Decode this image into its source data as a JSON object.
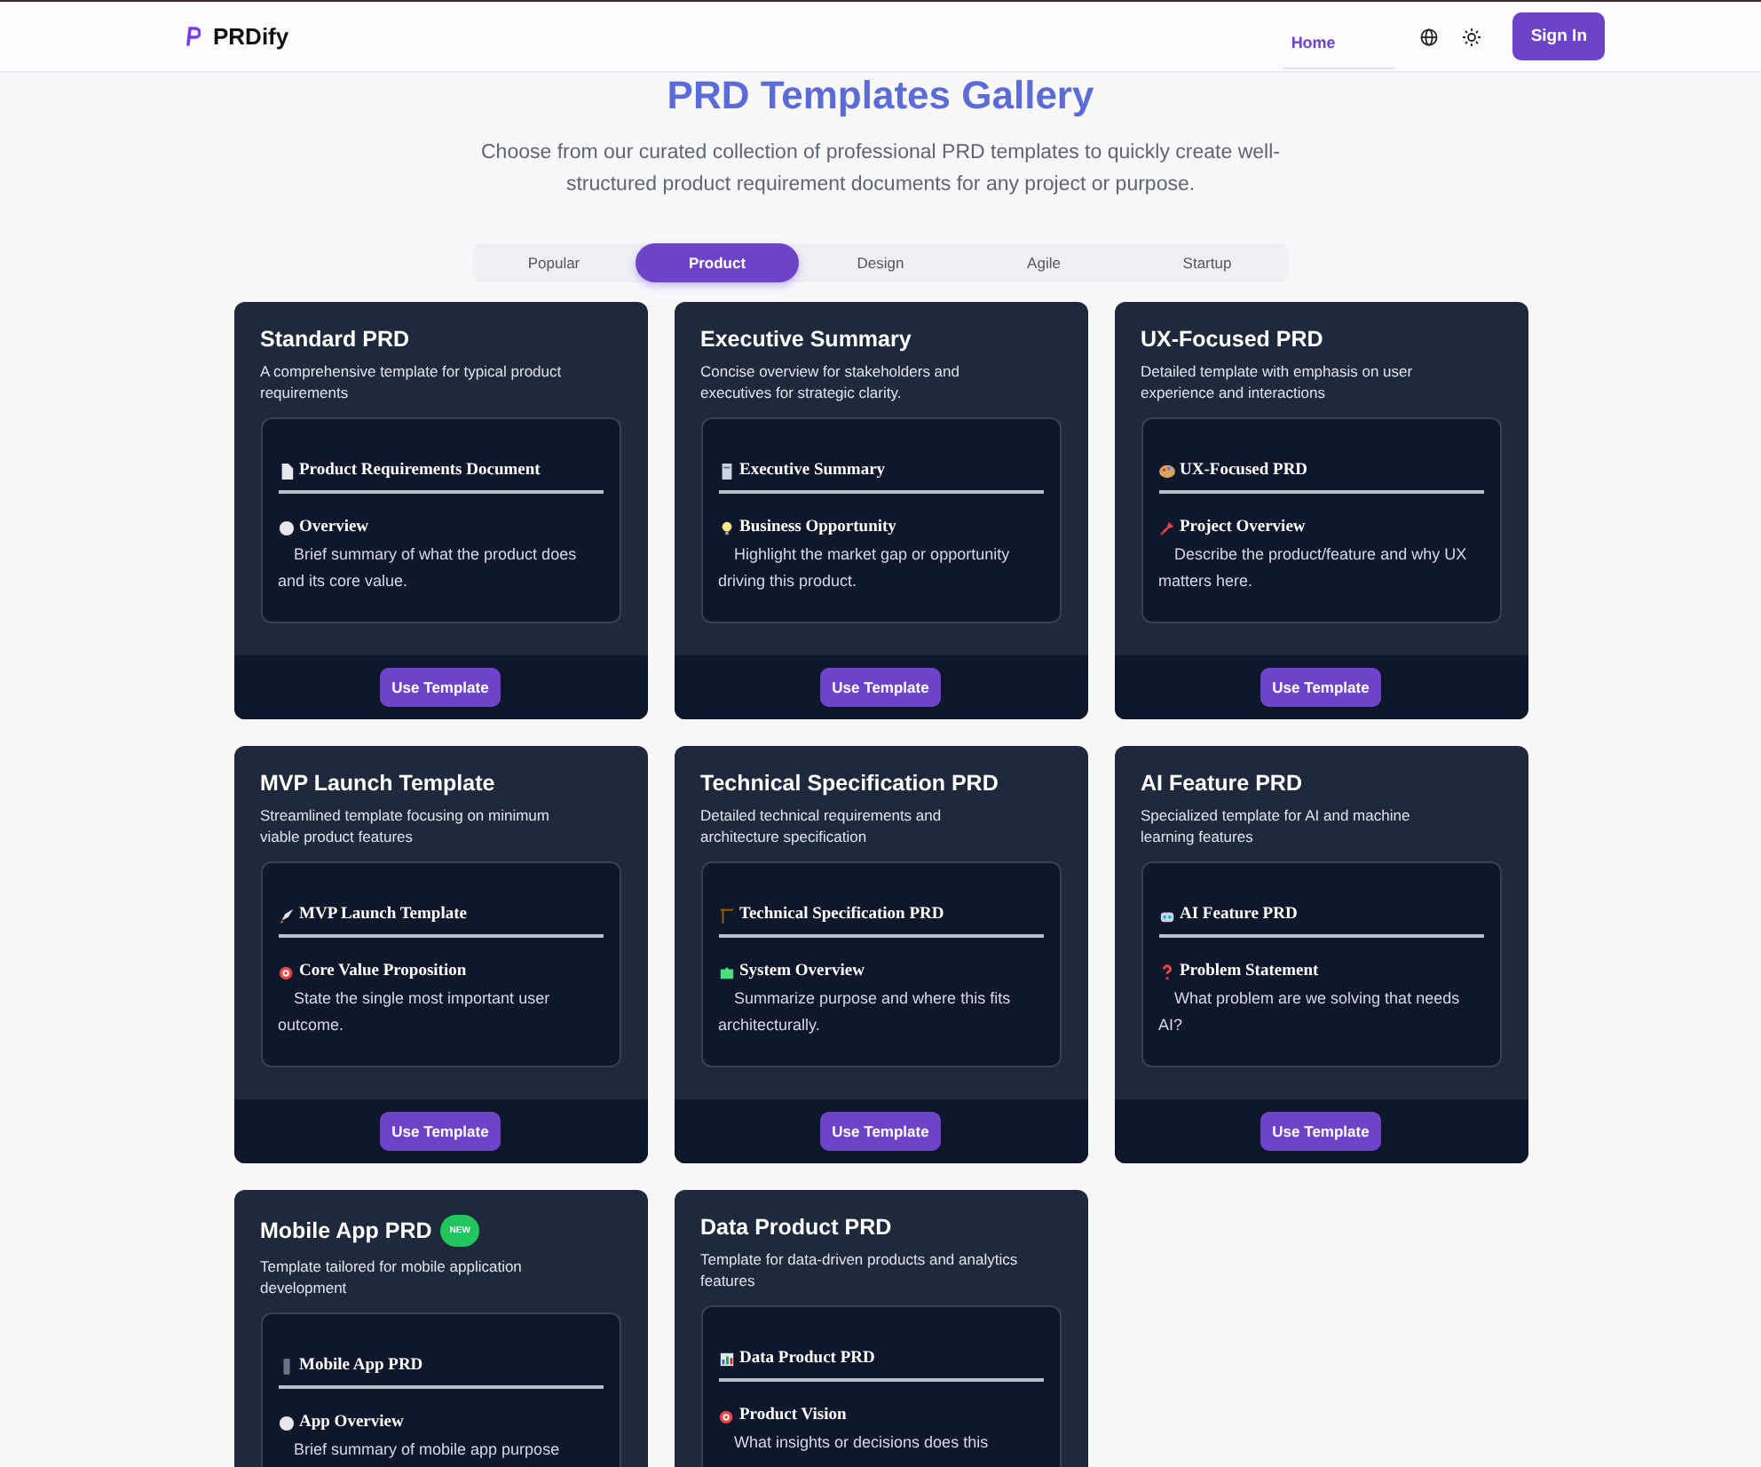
{
  "brand": "PRDify",
  "nav": [
    {
      "label": "Home",
      "selected": true
    }
  ],
  "sign_in": "Sign In",
  "title": "PRD Templates Gallery",
  "subtitle": "Choose from our curated collection of professional PRD templates to quickly create well-structured product requirement documents for any project or purpose.",
  "tabs": [
    {
      "label": "Popular",
      "selected": false
    },
    {
      "label": "Product",
      "selected": true
    },
    {
      "label": "Design",
      "selected": false
    },
    {
      "label": "Agile",
      "selected": false
    },
    {
      "label": "Startup",
      "selected": false
    }
  ],
  "cards": [
    {
      "title": "Standard PRD",
      "description": "A comprehensive template for typical product requirements",
      "preview_heading": "Product Requirements Document",
      "section_heading": "Overview",
      "section_text": "Brief summary of what the product does and its core value.",
      "button": "Use Template"
    },
    {
      "title": "Executive Summary",
      "description": "Concise overview for stakeholders and executives for strategic clarity.",
      "preview_heading": "Executive Summary",
      "section_heading": "Business Opportunity",
      "section_text": "Highlight the market gap or opportunity driving this product.",
      "button": "Use Template"
    },
    {
      "title": "UX-Focused PRD",
      "description": "Detailed template with emphasis on user experience and interactions",
      "preview_heading": "UX-Focused PRD",
      "section_heading": "Project Overview",
      "section_text": "Describe the product/feature and why UX matters here.",
      "button": "Use Template"
    },
    {
      "title": "MVP Launch Template",
      "description": "Streamlined template focusing on minimum viable product features",
      "preview_heading": "MVP Launch Template",
      "section_heading": "Core Value Proposition",
      "section_text": "State the single most important user outcome.",
      "button": "Use Template"
    },
    {
      "title": "Technical Specification PRD",
      "description": "Detailed technical requirements and architecture specification",
      "preview_heading": "Technical Specification PRD",
      "section_heading": "System Overview",
      "section_text": "Summarize purpose and where this fits architecturally.",
      "button": "Use Template"
    },
    {
      "title": "AI Feature PRD",
      "description": "Specialized template for AI and machine learning features",
      "preview_heading": "AI Feature PRD",
      "section_heading": "Problem Statement",
      "section_text": "What problem are we solving that needs AI?",
      "button": "Use Template"
    },
    {
      "title": "Mobile App PRD",
      "badge": "NEW",
      "description": "Template tailored for mobile application development",
      "preview_heading": "Mobile App PRD",
      "section_heading": "App Overview",
      "section_text": "Brief summary of mobile app purpose"
    },
    {
      "title": "Data Product PRD",
      "description": "Template for data-driven products and analytics features",
      "preview_heading": "Data Product PRD",
      "section_heading": "Product Vision",
      "section_text": "What insights or decisions does this"
    }
  ]
}
